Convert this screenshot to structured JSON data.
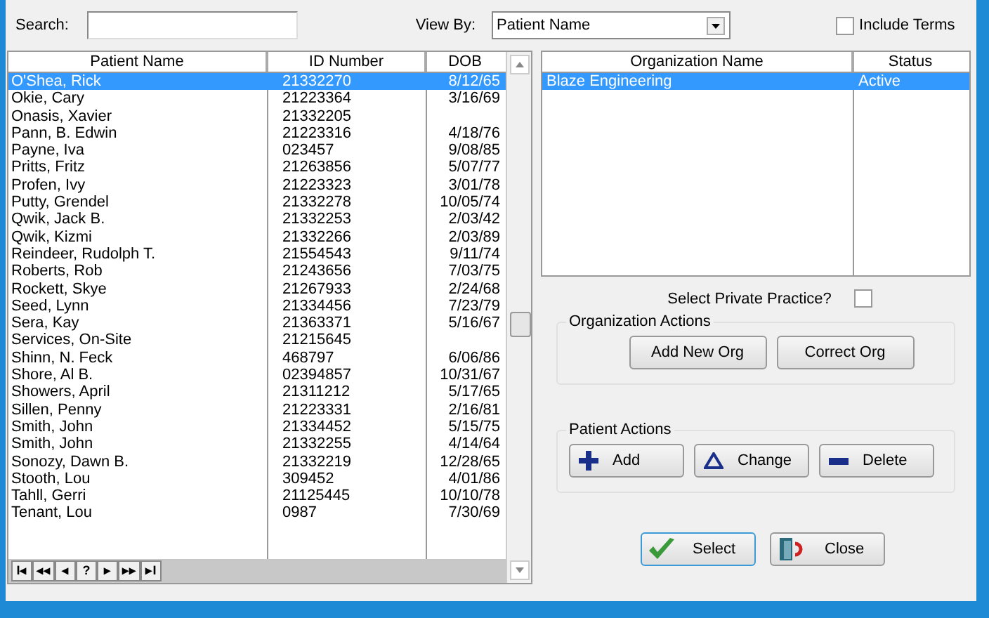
{
  "search": {
    "label": "Search:"
  },
  "view_by": {
    "label": "View By:",
    "value": "Patient Name"
  },
  "include_terms": {
    "label": "Include Terms",
    "checked": false
  },
  "patients": {
    "columns": [
      "Patient Name",
      "ID Number",
      "DOB"
    ],
    "rows": [
      {
        "name": "O'Shea, Rick",
        "id": "21332270",
        "dob": "8/12/65",
        "selected": true
      },
      {
        "name": "Okie, Cary",
        "id": "21223364",
        "dob": "3/16/69",
        "selected": false
      },
      {
        "name": "Onasis, Xavier",
        "id": "21332205",
        "selected": false
      },
      {
        "name": "Pann, B. Edwin",
        "id": "21223316",
        "dob": "4/18/76",
        "selected": false
      },
      {
        "name": "Payne, Iva",
        "id": "023457",
        "dob": "9/08/85",
        "selected": false
      },
      {
        "name": "Pritts, Fritz",
        "id": "21263856",
        "dob": "5/07/77",
        "selected": false
      },
      {
        "name": "Profen, Ivy",
        "id": "21223323",
        "dob": "3/01/78",
        "selected": false
      },
      {
        "name": "Putty, Grendel",
        "id": "21332278",
        "dob": "10/05/74",
        "selected": false
      },
      {
        "name": "Qwik, Jack B.",
        "id": "21332253",
        "dob": "2/03/42",
        "selected": false
      },
      {
        "name": "Qwik, Kizmi",
        "id": "21332266",
        "dob": "2/03/89",
        "selected": false
      },
      {
        "name": "Reindeer, Rudolph T.",
        "id": "21554543",
        "dob": "9/11/74",
        "selected": false
      },
      {
        "name": "Roberts, Rob",
        "id": "21243656",
        "dob": "7/03/75",
        "selected": false
      },
      {
        "name": "Rockett, Skye",
        "id": "21267933",
        "dob": "2/24/68",
        "selected": false
      },
      {
        "name": "Seed, Lynn",
        "id": "21334456",
        "dob": "7/23/79",
        "selected": false
      },
      {
        "name": "Sera, Kay",
        "id": "21363371",
        "dob": "5/16/67",
        "selected": false
      },
      {
        "name": "Services, On-Site",
        "id": "21215645",
        "selected": false
      },
      {
        "name": "Shinn, N. Feck",
        "id": "468797",
        "dob": "6/06/86",
        "selected": false
      },
      {
        "name": "Shore, Al B.",
        "id": "02394857",
        "dob": "10/31/67",
        "selected": false
      },
      {
        "name": "Showers, April",
        "id": "21311212",
        "dob": "5/17/65",
        "selected": false
      },
      {
        "name": "Sillen, Penny",
        "id": "21223331",
        "dob": "2/16/81",
        "selected": false
      },
      {
        "name": "Smith, John",
        "id": "21334452",
        "dob": "5/15/75",
        "selected": false
      },
      {
        "name": "Smith, John",
        "id": "21332255",
        "dob": "4/14/64",
        "selected": false
      },
      {
        "name": "Sonozy, Dawn B.",
        "id": "21332219",
        "dob": "12/28/65",
        "selected": false
      },
      {
        "name": "Stooth, Lou",
        "id": "309452",
        "dob": "4/01/86",
        "selected": false
      },
      {
        "name": "Tahll, Gerri",
        "id": "21125445",
        "dob": "10/10/78",
        "selected": false
      },
      {
        "name": "Tenant, Lou",
        "id": "0987",
        "dob": "7/30/69",
        "selected": false
      }
    ]
  },
  "nav_buttons": [
    "I◂",
    "◂◂",
    "◂",
    "?",
    "▸",
    "▸▸",
    "▸I"
  ],
  "organizations": {
    "columns": [
      "Organization Name",
      "Status"
    ],
    "rows": [
      {
        "name": "Blaze Engineering",
        "status": "Active",
        "selected": true
      }
    ]
  },
  "private_practice": {
    "label": "Select Private Practice?",
    "checked": false
  },
  "organization_actions": {
    "title": "Organization Actions",
    "buttons": [
      "Add New Org",
      "Correct Org"
    ]
  },
  "patient_actions": {
    "title": "Patient Actions",
    "buttons": [
      {
        "kind": "add",
        "label": "Add"
      },
      {
        "kind": "change",
        "label": "Change"
      },
      {
        "kind": "delete",
        "label": "Delete"
      }
    ]
  },
  "footer_buttons": [
    {
      "kind": "select",
      "label": "Select"
    },
    {
      "kind": "close",
      "label": "Close"
    }
  ]
}
